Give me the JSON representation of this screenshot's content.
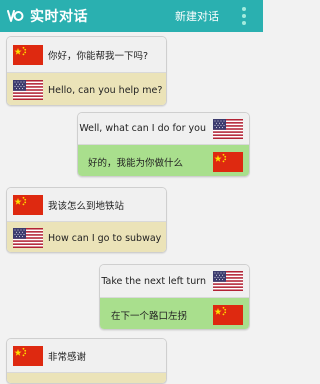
{
  "header": {
    "title": "实时对话",
    "new_chat": "新建对话"
  },
  "messages": [
    {
      "side": "left",
      "top_text": "你好，你能帮我一下吗?",
      "bottom_text": "Hello, can you help me?"
    },
    {
      "side": "right",
      "top_text": "Well, what can I do for you",
      "bottom_text": "好的，我能为你做什么"
    },
    {
      "side": "left",
      "top_text": "我该怎么到地铁站",
      "bottom_text": "How can I go to subway"
    },
    {
      "side": "right",
      "top_text": "Take the next left turn",
      "bottom_text": "在下一个路口左拐"
    },
    {
      "side": "left",
      "top_text": "非常感谢",
      "bottom_text": ""
    }
  ],
  "colors": {
    "header_bg": "#2ab0b0",
    "chinese_row_left_bg": "#ebe3b8",
    "chinese_row_right_bg": "#a9df8d"
  },
  "icons": [
    "app-logo-icon",
    "more-menu-icon",
    "china-flag-icon",
    "us-flag-icon"
  ]
}
